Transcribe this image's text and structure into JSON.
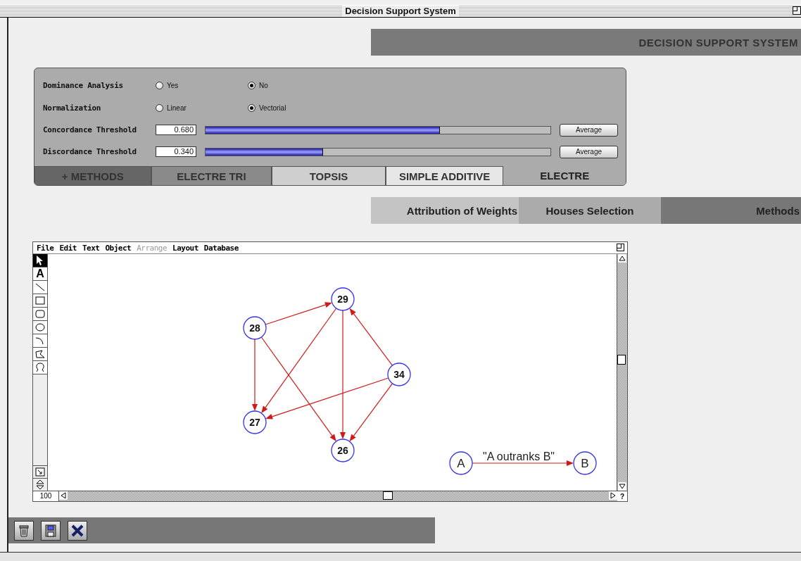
{
  "window": {
    "title": "Decision Support System"
  },
  "header": {
    "title": "DECISION SUPPORT SYSTEM"
  },
  "options": [
    {
      "label": "Dominance Analysis",
      "choices": [
        {
          "label": "Yes",
          "selected": false
        },
        {
          "label": "No",
          "selected": true
        }
      ]
    },
    {
      "label": "Normalization",
      "choices": [
        {
          "label": "Linear",
          "selected": false
        },
        {
          "label": "Vectorial",
          "selected": true
        }
      ]
    }
  ],
  "thresholds": [
    {
      "label": "Concordance Threshold",
      "value": "0.680",
      "level": 0.68,
      "button": "Average"
    },
    {
      "label": "Discordance Threshold",
      "value": "0.340",
      "level": 0.34,
      "button": "Average"
    }
  ],
  "method_tabs": [
    {
      "label": "+ METHODS",
      "selected": false
    },
    {
      "label": "ELECTRE TRI",
      "selected": false
    },
    {
      "label": "TOPSIS",
      "selected": false
    },
    {
      "label": "SIMPLE ADDITIVE",
      "selected": false
    },
    {
      "label": "ELECTRE",
      "selected": true
    }
  ],
  "nav_tabs": [
    {
      "label": "Attribution of Weights",
      "selected": false
    },
    {
      "label": "Houses Selection",
      "selected": false
    },
    {
      "label": "Methods",
      "selected": true
    }
  ],
  "drawing_window": {
    "menu": [
      {
        "label": "File",
        "disabled": false
      },
      {
        "label": "Edit",
        "disabled": false
      },
      {
        "label": "Text",
        "disabled": false
      },
      {
        "label": "Object",
        "disabled": false
      },
      {
        "label": "Arrange",
        "disabled": true
      },
      {
        "label": "Layout",
        "disabled": false
      },
      {
        "label": "Database",
        "disabled": false
      }
    ],
    "tools": [
      {
        "kind": "pointer",
        "selected": true
      },
      {
        "kind": "text",
        "label": "A",
        "selected": false
      },
      {
        "kind": "line",
        "selected": false
      },
      {
        "kind": "rect",
        "selected": false
      },
      {
        "kind": "roundrect",
        "selected": false
      },
      {
        "kind": "oval",
        "selected": false
      },
      {
        "kind": "arc",
        "selected": false
      },
      {
        "kind": "polygon",
        "selected": false
      },
      {
        "kind": "freehand",
        "selected": false
      }
    ],
    "nodes": [
      "29",
      "28",
      "34",
      "27",
      "26"
    ],
    "legend": {
      "from": "A",
      "to": "B",
      "label": "\"A outranks B\""
    },
    "zoom": "100",
    "help": "?"
  }
}
